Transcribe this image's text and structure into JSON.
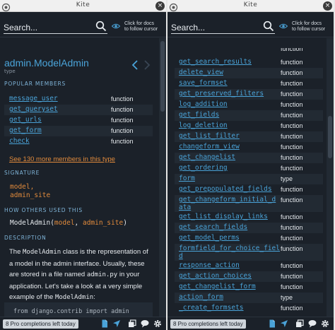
{
  "left_window": {
    "title": "Kite",
    "close_glyph": "×",
    "search": {
      "placeholder": "Search..."
    },
    "follow_cursor": {
      "line1": "Click for docs",
      "line2": "to follow cursor"
    },
    "doc": {
      "title": "admin.ModelAdmin",
      "kind": "type",
      "sections": {
        "popular_members": "POPULAR MEMBERS",
        "signature": "SIGNATURE",
        "how_others_used": "HOW OTHERS USED THIS",
        "description": "DESCRIPTION"
      },
      "members": [
        {
          "name": "message_user",
          "kind": "function"
        },
        {
          "name": "get_queryset",
          "kind": "function"
        },
        {
          "name": "get_urls",
          "kind": "function"
        },
        {
          "name": "get_form",
          "kind": "function"
        },
        {
          "name": "check",
          "kind": "function"
        }
      ],
      "more_link": "See 130 more members in this type",
      "signature_params": [
        "model,",
        "admin_site"
      ],
      "usage": {
        "fn": "ModelAdmin(",
        "arg1": "model",
        "sep": ", ",
        "arg2": "admin_site",
        "close": ")"
      },
      "description": {
        "p1": "The ",
        "code1": "ModelAdmin",
        "p2": " class is the representation of a model in the admin interface. Usually, these are stored in a file named ",
        "code2": "admin.py",
        "p3": " in your application. Let's take a look at a very simple example of the ",
        "code3": "ModelAdmin",
        "p4": ":"
      },
      "code_line": "from django.contrib import admin"
    },
    "status": {
      "badge": "8 Pro completions left today"
    }
  },
  "right_window": {
    "title": "Kite",
    "close_glyph": "×",
    "search": {
      "placeholder": "Search..."
    },
    "follow_cursor": {
      "line1": "Click for docs",
      "line2": "to follow cursor"
    },
    "partial_top_row": {
      "kind": "function"
    },
    "items": [
      {
        "name": "get_search_results",
        "kind": "function"
      },
      {
        "name": "delete_view",
        "kind": "function"
      },
      {
        "name": "save_formset",
        "kind": "function"
      },
      {
        "name": "get_preserved_filters",
        "kind": "function"
      },
      {
        "name": "log_addition",
        "kind": "function"
      },
      {
        "name": "get_fields",
        "kind": "function"
      },
      {
        "name": "log_deletion",
        "kind": "function"
      },
      {
        "name": "get_list_filter",
        "kind": "function"
      },
      {
        "name": "changeform_view",
        "kind": "function"
      },
      {
        "name": "get_changelist",
        "kind": "function"
      },
      {
        "name": "get_ordering",
        "kind": "function"
      },
      {
        "name": "form",
        "kind": "type"
      },
      {
        "name": "get_prepopulated_fields",
        "kind": "function"
      },
      {
        "name": "get_changeform_initial_d",
        "name2": "ata",
        "kind": "function"
      },
      {
        "name": "get_list_display_links",
        "kind": "function"
      },
      {
        "name": "get_search_fields",
        "kind": "function"
      },
      {
        "name": "get_model_perms",
        "kind": "function"
      },
      {
        "name": "formfield_for_choice_fiel",
        "name2": "d",
        "kind": "function"
      },
      {
        "name": "response_action",
        "kind": "function"
      },
      {
        "name": "get_action_choices",
        "kind": "function"
      },
      {
        "name": "get_changelist_form",
        "kind": "function"
      },
      {
        "name": "action_form",
        "kind": "type"
      },
      {
        "name": "_create_formsets",
        "kind": "function"
      }
    ],
    "status": {
      "badge": "8 Pro completions left today"
    }
  },
  "colors": {
    "background": "#1b2129",
    "link": "#4aa3d8",
    "accent": "#e08a3c",
    "text": "#e6eaee"
  }
}
